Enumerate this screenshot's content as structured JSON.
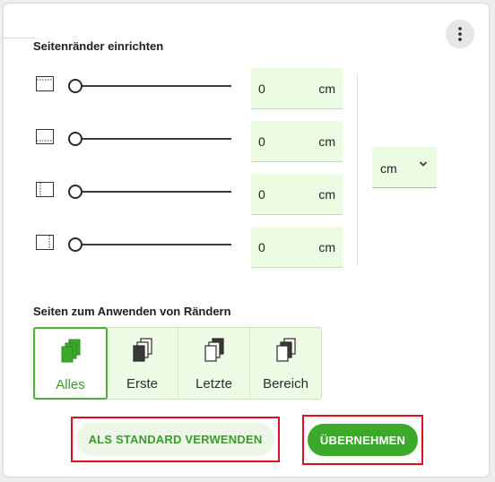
{
  "dialog": {
    "title": "Seitenränder einrichten",
    "more_icon": "more-vertical-icon"
  },
  "margins": [
    {
      "side": "top",
      "icon": "margin-top-icon",
      "slider_fraction": 0,
      "value": "0",
      "unit": "cm"
    },
    {
      "side": "bottom",
      "icon": "margin-bottom-icon",
      "slider_fraction": 0,
      "value": "0",
      "unit": "cm"
    },
    {
      "side": "left",
      "icon": "margin-left-icon",
      "slider_fraction": 0,
      "value": "0",
      "unit": "cm"
    },
    {
      "side": "right",
      "icon": "margin-right-icon",
      "slider_fraction": 0,
      "value": "0",
      "unit": "cm"
    }
  ],
  "unit_select": {
    "value": "cm",
    "icon": "chevron-down-icon"
  },
  "apply_pages": {
    "title": "Seiten zum Anwenden von Rändern",
    "options": [
      {
        "label": "Alles",
        "icon": "all-pages-icon",
        "selected": true
      },
      {
        "label": "Erste",
        "icon": "first-page-icon",
        "selected": false
      },
      {
        "label": "Letzte",
        "icon": "last-page-icon",
        "selected": false
      },
      {
        "label": "Bereich",
        "icon": "page-range-icon",
        "selected": false
      }
    ]
  },
  "buttons": {
    "set_default": "ALS STANDARD VERWENDEN",
    "apply": "ÜBERNEHMEN"
  },
  "colors": {
    "accent": "#3da92a",
    "field_bg": "#ecfce3",
    "highlight_box": "#e0101a"
  }
}
